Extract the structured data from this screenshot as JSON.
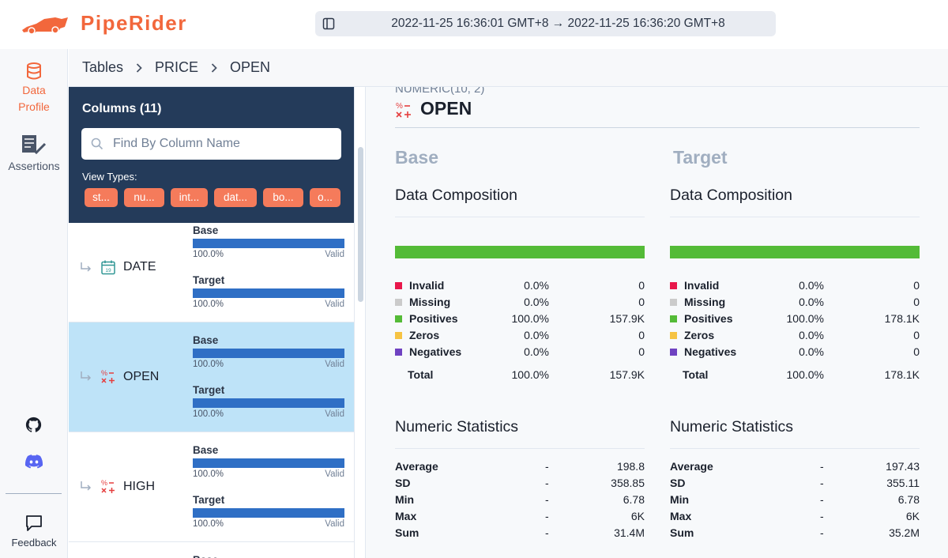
{
  "app": {
    "name": "PipeRider",
    "brand_color": "#f2673c",
    "range": "2022-11-25 16:36:01 GMT+8 → 2022-11-25 16:36:20 GMT+8"
  },
  "sidenav": {
    "profile_line1": "Data",
    "profile_line2": "Profile",
    "assertions": "Assertions",
    "feedback": "Feedback"
  },
  "breadcrumb": [
    "Tables",
    "PRICE",
    "OPEN"
  ],
  "columns_panel": {
    "title": "Columns (11)",
    "search_placeholder": "Find By Column Name",
    "view_types_label": "View Types:",
    "chips": [
      "st...",
      "nu...",
      "int...",
      "dat...",
      "bo...",
      "o..."
    ],
    "rows": [
      {
        "name": "DATE",
        "icon": "calendar-icon",
        "base_label": "Base",
        "base_pct": "100.0%",
        "base_status": "Valid",
        "base_valid_fraction": 1.0,
        "target_label": "Target",
        "target_pct": "100.0%",
        "target_status": "Valid",
        "target_valid_fraction": 1.0
      },
      {
        "name": "OPEN",
        "icon": "numeric-icon",
        "base_label": "Base",
        "base_pct": "100.0%",
        "base_status": "Valid",
        "base_valid_fraction": 1.0,
        "target_label": "Target",
        "target_pct": "100.0%",
        "target_status": "Valid",
        "target_valid_fraction": 1.0
      },
      {
        "name": "HIGH",
        "icon": "numeric-icon",
        "base_label": "Base",
        "base_pct": "100.0%",
        "base_status": "Valid",
        "base_valid_fraction": 1.0,
        "target_label": "Target",
        "target_pct": "100.0%",
        "target_status": "Valid",
        "target_valid_fraction": 1.0
      }
    ]
  },
  "main": {
    "column_type": "NUMERIC(10, 2)",
    "column_name": "OPEN",
    "base": {
      "heading": "Base",
      "composition_title": "Data Composition",
      "composition": [
        {
          "name": "Invalid",
          "pct": "0.0%",
          "count": "0",
          "color": "#e8174b"
        },
        {
          "name": "Missing",
          "pct": "0.0%",
          "count": "0",
          "color": "#cbcbcb"
        },
        {
          "name": "Positives",
          "pct": "100.0%",
          "count": "157.9K",
          "color": "#54bb37"
        },
        {
          "name": "Zeros",
          "pct": "0.0%",
          "count": "0",
          "color": "#f6c343"
        },
        {
          "name": "Negatives",
          "pct": "0.0%",
          "count": "0",
          "color": "#6f42c1"
        }
      ],
      "total": {
        "name": "Total",
        "pct": "100.0%",
        "count": "157.9K"
      },
      "stats_title": "Numeric Statistics",
      "stats": [
        {
          "name": "Average",
          "dash": "-",
          "value": "198.8"
        },
        {
          "name": "SD",
          "dash": "-",
          "value": "358.85"
        },
        {
          "name": "Min",
          "dash": "-",
          "value": "6.78"
        },
        {
          "name": "Max",
          "dash": "-",
          "value": "6K"
        },
        {
          "name": "Sum",
          "dash": "-",
          "value": "31.4M"
        }
      ]
    },
    "target": {
      "heading": "Target",
      "composition_title": "Data Composition",
      "composition": [
        {
          "name": "Invalid",
          "pct": "0.0%",
          "count": "0",
          "color": "#e8174b"
        },
        {
          "name": "Missing",
          "pct": "0.0%",
          "count": "0",
          "color": "#cbcbcb"
        },
        {
          "name": "Positives",
          "pct": "100.0%",
          "count": "178.1K",
          "color": "#54bb37"
        },
        {
          "name": "Zeros",
          "pct": "0.0%",
          "count": "0",
          "color": "#f6c343"
        },
        {
          "name": "Negatives",
          "pct": "0.0%",
          "count": "0",
          "color": "#6f42c1"
        }
      ],
      "total": {
        "name": "Total",
        "pct": "100.0%",
        "count": "178.1K"
      },
      "stats_title": "Numeric Statistics",
      "stats": [
        {
          "name": "Average",
          "dash": "-",
          "value": "197.43"
        },
        {
          "name": "SD",
          "dash": "-",
          "value": "355.11"
        },
        {
          "name": "Min",
          "dash": "-",
          "value": "6.78"
        },
        {
          "name": "Max",
          "dash": "-",
          "value": "6K"
        },
        {
          "name": "Sum",
          "dash": "-",
          "value": "35.2M"
        }
      ]
    }
  }
}
